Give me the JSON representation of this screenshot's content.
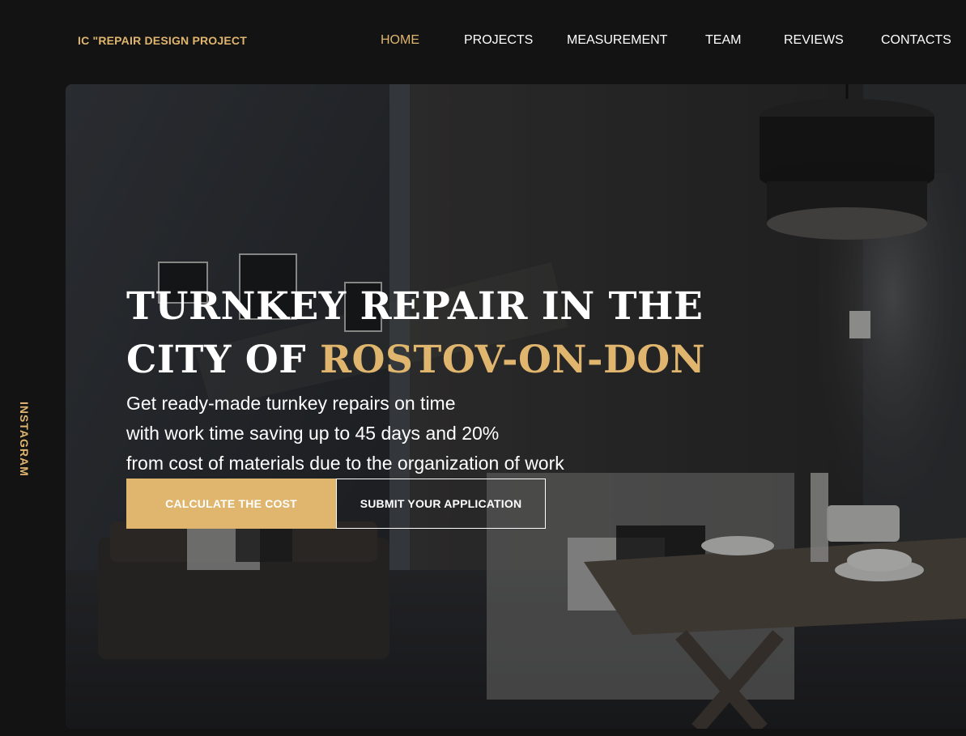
{
  "colors": {
    "accent": "#e0b56e",
    "background": "#131313",
    "text": "#ffffff"
  },
  "header": {
    "logo": "IC \"REPAIR DESIGN PROJECT",
    "nav": [
      {
        "label": "HOME",
        "active": true
      },
      {
        "label": "PROJECTS",
        "active": false
      },
      {
        "label": "MEASUREMENT",
        "active": false
      },
      {
        "label": "TEAM",
        "active": false
      },
      {
        "label": "REVIEWS",
        "active": false
      },
      {
        "label": "CONTACTS",
        "active": false
      }
    ]
  },
  "sidebar": {
    "instagram_label": "INSTAGRAM"
  },
  "hero": {
    "headline_line1": "TURNKEY REPAIR IN THE",
    "headline_line2_prefix": "CITY OF ",
    "headline_accent": "ROSTOV-ON-DON",
    "subtext": [
      "Get ready-made turnkey repairs on time",
      "with work time saving up to 45 days and 20%",
      "from cost of materials due to the organization of work"
    ],
    "primary_button": "CALCULATE THE COST",
    "secondary_button": "SUBMIT YOUR APPLICATION"
  }
}
